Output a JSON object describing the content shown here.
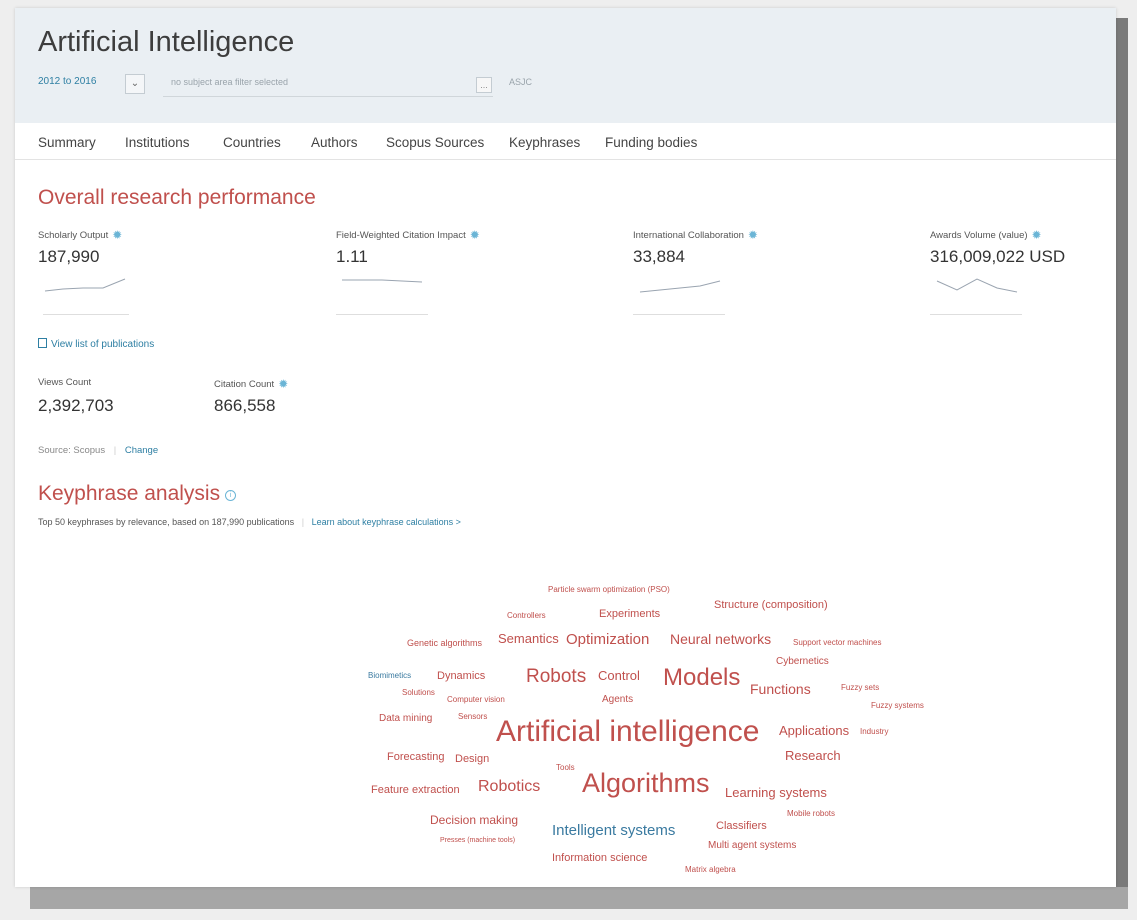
{
  "header": {
    "title": "Artificial Intelligence",
    "date_range": "2012 to 2016",
    "subject_placeholder": "no subject area filter selected",
    "subject_button": "...",
    "classification": "ASJC"
  },
  "tabs": [
    "Summary",
    "Institutions",
    "Countries",
    "Authors",
    "Scopus Sources",
    "Keyphrases",
    "Funding bodies"
  ],
  "performance": {
    "title": "Overall research performance",
    "metrics": [
      {
        "label": "Scholarly Output",
        "value": "187,990"
      },
      {
        "label": "Field-Weighted Citation Impact",
        "value": "1.11"
      },
      {
        "label": "International Collaboration",
        "value": "33,884"
      },
      {
        "label": "Awards Volume (value)",
        "value": "316,009,022 USD"
      }
    ],
    "view_list": "View list of publications",
    "secondary_metrics": [
      {
        "label": "Views Count",
        "value": "2,392,703"
      },
      {
        "label": "Citation Count",
        "value": "866,558"
      }
    ],
    "source_label": "Source: Scopus",
    "separator": "|",
    "change_link": "Change"
  },
  "keyphrases": {
    "title": "Keyphrase analysis",
    "info_icon": "i",
    "description": "Top 50 keyphrases by relevance, based on 187,990 publications",
    "separator": "|",
    "learn_link": "Learn about keyphrase calculations >",
    "words": [
      {
        "text": "Particle swarm optimization (PSO)",
        "color": "red"
      },
      {
        "text": "Controllers",
        "color": "red"
      },
      {
        "text": "Experiments",
        "color": "red"
      },
      {
        "text": "Structure (composition)",
        "color": "red"
      },
      {
        "text": "Genetic algorithms",
        "color": "red"
      },
      {
        "text": "Semantics",
        "color": "red"
      },
      {
        "text": "Optimization",
        "color": "red"
      },
      {
        "text": "Neural networks",
        "color": "red"
      },
      {
        "text": "Support vector machines",
        "color": "red"
      },
      {
        "text": "Cybernetics",
        "color": "red"
      },
      {
        "text": "Biomimetics",
        "color": "blue"
      },
      {
        "text": "Dynamics",
        "color": "red"
      },
      {
        "text": "Robots",
        "color": "red"
      },
      {
        "text": "Control",
        "color": "red"
      },
      {
        "text": "Models",
        "color": "red"
      },
      {
        "text": "Functions",
        "color": "red"
      },
      {
        "text": "Fuzzy sets",
        "color": "red"
      },
      {
        "text": "Solutions",
        "color": "red"
      },
      {
        "text": "Computer vision",
        "color": "red"
      },
      {
        "text": "Agents",
        "color": "red"
      },
      {
        "text": "Fuzzy systems",
        "color": "red"
      },
      {
        "text": "Data mining",
        "color": "red"
      },
      {
        "text": "Sensors",
        "color": "red"
      },
      {
        "text": "Artificial intelligence",
        "color": "red"
      },
      {
        "text": "Applications",
        "color": "red"
      },
      {
        "text": "Industry",
        "color": "red"
      },
      {
        "text": "Research",
        "color": "red"
      },
      {
        "text": "Forecasting",
        "color": "red"
      },
      {
        "text": "Design",
        "color": "red"
      },
      {
        "text": "Tools",
        "color": "red"
      },
      {
        "text": "Feature extraction",
        "color": "red"
      },
      {
        "text": "Robotics",
        "color": "red"
      },
      {
        "text": "Algorithms",
        "color": "red"
      },
      {
        "text": "Learning systems",
        "color": "red"
      },
      {
        "text": "Mobile robots",
        "color": "red"
      },
      {
        "text": "Decision making",
        "color": "red"
      },
      {
        "text": "Intelligent systems",
        "color": "blue"
      },
      {
        "text": "Classifiers",
        "color": "red"
      },
      {
        "text": "Presses (machine tools)",
        "color": "red"
      },
      {
        "text": "Multi agent systems",
        "color": "red"
      },
      {
        "text": "Information science",
        "color": "red"
      },
      {
        "text": "Matrix algebra",
        "color": "red"
      }
    ]
  },
  "colors": {
    "accent_red": "#c0504d",
    "link_blue": "#2e7fa3",
    "icon_blue": "#6bb5d6"
  },
  "icons": {
    "gear": "settings-gear-icon",
    "dropdown": "chevron-down-icon",
    "document": "document-icon"
  }
}
